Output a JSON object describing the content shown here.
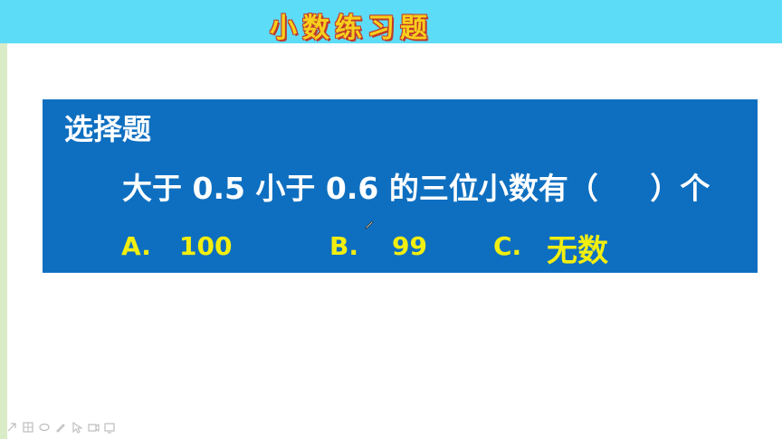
{
  "header": {
    "title": "小数练习题"
  },
  "question": {
    "section_label": "选择题",
    "text": "大于 0.5 小于 0.6 的三位小数有（     ）个"
  },
  "options": [
    {
      "label": "A.",
      "value": "100"
    },
    {
      "label": "B.",
      "value": "99"
    },
    {
      "label": "C.",
      "value": "无数"
    }
  ],
  "colors": {
    "header_bg": "#5ddcf7",
    "title_fill": "#f7cf1c",
    "title_outline": "#c0392b",
    "box_bg": "#0e6fc0",
    "option_color": "#f2ee10"
  },
  "toolbar": {
    "icons": [
      "arrow-icon",
      "grid-icon",
      "eraser-icon",
      "pen-icon",
      "pointer-icon",
      "camera-icon",
      "screen-icon"
    ]
  }
}
